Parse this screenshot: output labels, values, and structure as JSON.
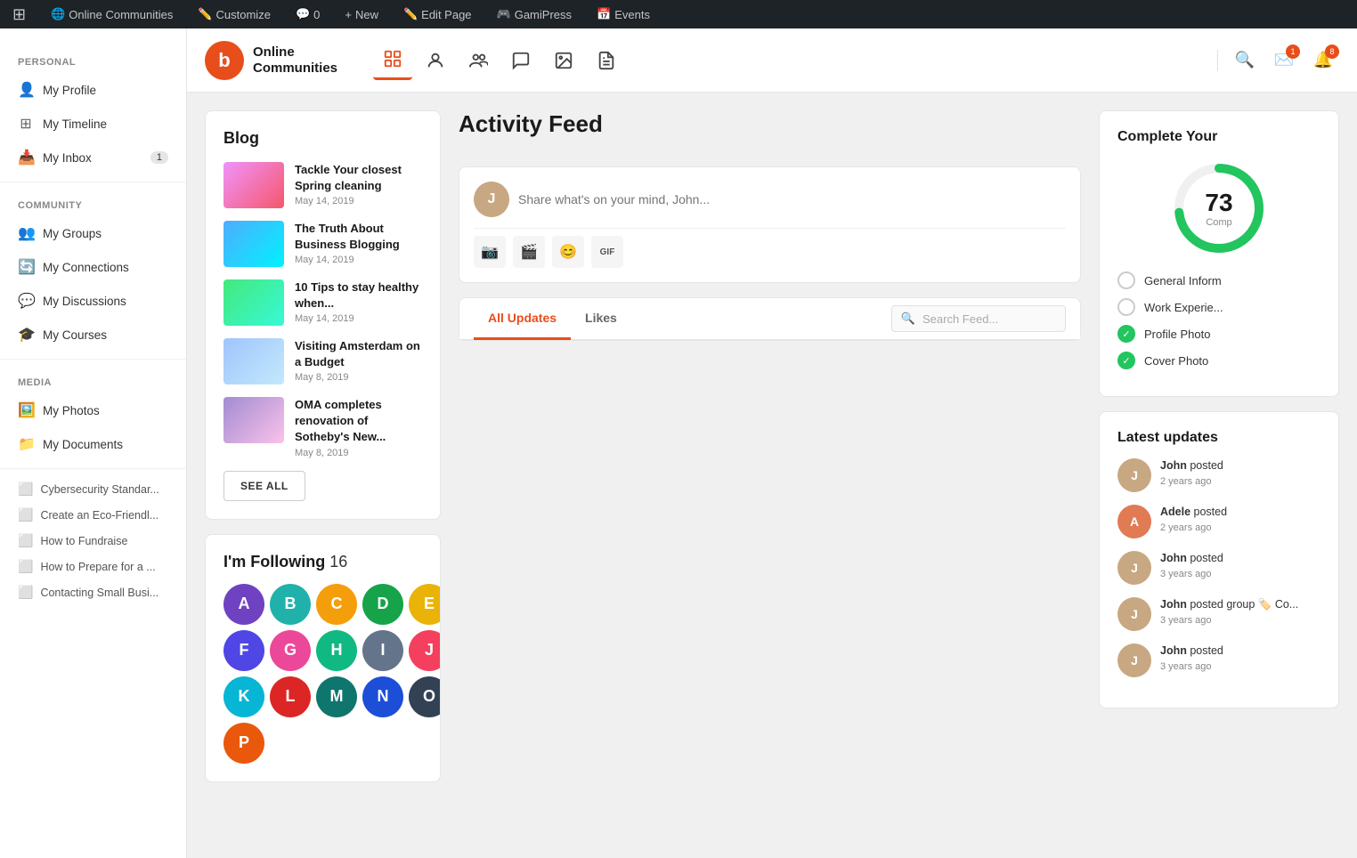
{
  "adminBar": {
    "wpIcon": "⊞",
    "items": [
      {
        "label": "Online Communities",
        "icon": "🌐"
      },
      {
        "label": "Customize",
        "icon": "✏️"
      },
      {
        "label": "0",
        "icon": "💬",
        "count": "0"
      },
      {
        "label": "New",
        "icon": "+"
      },
      {
        "label": "Edit Page",
        "icon": "✏️"
      },
      {
        "label": "GamiPress",
        "icon": "🎮"
      },
      {
        "label": "Events",
        "icon": "📅"
      }
    ]
  },
  "sidebar": {
    "personalLabel": "PERSONAL",
    "personalItems": [
      {
        "id": "my-profile",
        "label": "My Profile",
        "icon": "👤"
      },
      {
        "id": "my-timeline",
        "label": "My Timeline",
        "icon": "➕"
      },
      {
        "id": "my-inbox",
        "label": "My Inbox",
        "icon": "📥",
        "badge": "1"
      }
    ],
    "communityLabel": "COMMUNITY",
    "communityItems": [
      {
        "id": "my-groups",
        "label": "My Groups",
        "icon": "👥"
      },
      {
        "id": "my-connections",
        "label": "My Connections",
        "icon": "🔄"
      },
      {
        "id": "my-discussions",
        "label": "My Discussions",
        "icon": "💬"
      },
      {
        "id": "my-courses",
        "label": "My Courses",
        "icon": "🎓"
      }
    ],
    "mediaLabel": "MEDIA",
    "mediaItems": [
      {
        "id": "my-photos",
        "label": "My Photos",
        "icon": "🖼️"
      },
      {
        "id": "my-documents",
        "label": "My Documents",
        "icon": "📁"
      }
    ],
    "docItems": [
      {
        "id": "doc-1",
        "label": "Cybersecurity Standar..."
      },
      {
        "id": "doc-2",
        "label": "Create an Eco-Friendl..."
      },
      {
        "id": "doc-3",
        "label": "How to Fundraise"
      },
      {
        "id": "doc-4",
        "label": "How to Prepare for a ..."
      },
      {
        "id": "doc-5",
        "label": "Contacting Small Busi..."
      }
    ]
  },
  "topNav": {
    "logoText1": "Online",
    "logoText2": "Communities",
    "logoSymbol": "b",
    "navIcons": [
      {
        "id": "home",
        "icon": "⊞",
        "active": true
      },
      {
        "id": "profile",
        "icon": "👤",
        "active": false
      },
      {
        "id": "groups",
        "icon": "👥",
        "active": false
      },
      {
        "id": "messages",
        "icon": "💬",
        "active": false
      },
      {
        "id": "media",
        "icon": "⬜",
        "active": false
      },
      {
        "id": "docs",
        "icon": "📋",
        "active": false
      }
    ],
    "rightIcons": [
      {
        "id": "search",
        "icon": "🔍"
      },
      {
        "id": "notifications-email",
        "icon": "✉️",
        "badge": "1"
      },
      {
        "id": "notifications-bell",
        "icon": "🔔",
        "badge": "8"
      }
    ]
  },
  "blog": {
    "title": "Blog",
    "items": [
      {
        "id": "blog-1",
        "title": "Tackle Your closest Spring cleaning",
        "date": "May 14, 2019",
        "thumbClass": "thumb-pink"
      },
      {
        "id": "blog-2",
        "title": "The Truth About Business Blogging",
        "date": "May 14, 2019",
        "thumbClass": "thumb-blue"
      },
      {
        "id": "blog-3",
        "title": "10 Tips to stay healthy when...",
        "date": "May 14, 2019",
        "thumbClass": "thumb-green"
      },
      {
        "id": "blog-4",
        "title": "Visiting Amsterdam on a Budget",
        "date": "May 8, 2019",
        "thumbClass": "thumb-sky"
      },
      {
        "id": "blog-5",
        "title": "OMA completes renovation of Sotheby's New...",
        "date": "May 8, 2019",
        "thumbClass": "thumb-purple"
      }
    ],
    "seeAllLabel": "SEE ALL"
  },
  "following": {
    "title": "I'm Following",
    "count": "16",
    "avatars": [
      {
        "id": "f1",
        "colorClass": "av-purple",
        "initial": "A"
      },
      {
        "id": "f2",
        "colorClass": "av-teal",
        "initial": "B"
      },
      {
        "id": "f3",
        "colorClass": "av-amber",
        "initial": "C"
      },
      {
        "id": "f4",
        "colorClass": "av-green",
        "initial": "D"
      },
      {
        "id": "f5",
        "colorClass": "av-yellow",
        "initial": "E"
      },
      {
        "id": "f6",
        "colorClass": "av-indigo",
        "initial": "F"
      },
      {
        "id": "f7",
        "colorClass": "av-pink",
        "initial": "G"
      },
      {
        "id": "f8",
        "colorClass": "av-emerald",
        "initial": "H"
      },
      {
        "id": "f9",
        "colorClass": "av-slate",
        "initial": "I"
      },
      {
        "id": "f10",
        "colorClass": "av-rose",
        "initial": "J"
      },
      {
        "id": "f11",
        "colorClass": "av-cyan",
        "initial": "K"
      },
      {
        "id": "f12",
        "colorClass": "av-red",
        "initial": "L"
      },
      {
        "id": "f13",
        "colorClass": "av-dark-teal",
        "initial": "M"
      },
      {
        "id": "f14",
        "colorClass": "av-dark-blue",
        "initial": "N"
      },
      {
        "id": "f15",
        "colorClass": "av-dark-slate",
        "initial": "O"
      },
      {
        "id": "f16",
        "colorClass": "av-warm-orange",
        "initial": "P"
      }
    ]
  },
  "activityFeed": {
    "title": "Activity Feed",
    "postPlaceholder": "Share what's on your mind, John...",
    "tabs": [
      {
        "id": "all-updates",
        "label": "All Updates",
        "active": true
      },
      {
        "id": "likes",
        "label": "Likes",
        "active": false
      }
    ],
    "searchPlaceholder": "Search Feed..."
  },
  "completeProfile": {
    "title": "Complete Your",
    "progressValue": 73,
    "progressLabel": "Comp",
    "items": [
      {
        "id": "general-info",
        "label": "General Inform",
        "done": false
      },
      {
        "id": "work-exp",
        "label": "Work Experie...",
        "done": false
      },
      {
        "id": "profile-photo",
        "label": "Profile Photo",
        "done": true
      },
      {
        "id": "cover-photo",
        "label": "Cover Photo",
        "done": true
      }
    ]
  },
  "latestUpdates": {
    "title": "Latest updates",
    "items": [
      {
        "id": "u1",
        "name": "John",
        "action": "posted",
        "time": "2 years ago",
        "colorClass": "av-warm-orange"
      },
      {
        "id": "u2",
        "name": "Adele",
        "action": "posted",
        "time": "2 years ago",
        "colorClass": "av-pink"
      },
      {
        "id": "u3",
        "name": "John",
        "action": "posted",
        "time": "3 years ago",
        "colorClass": "av-warm-orange"
      },
      {
        "id": "u4",
        "name": "John",
        "action": "posted group 🏷️ Co...",
        "time": "3 years ago",
        "colorClass": "av-warm-orange"
      },
      {
        "id": "u5",
        "name": "John",
        "action": "posted",
        "time": "3 years ago",
        "colorClass": "av-warm-orange"
      }
    ]
  }
}
